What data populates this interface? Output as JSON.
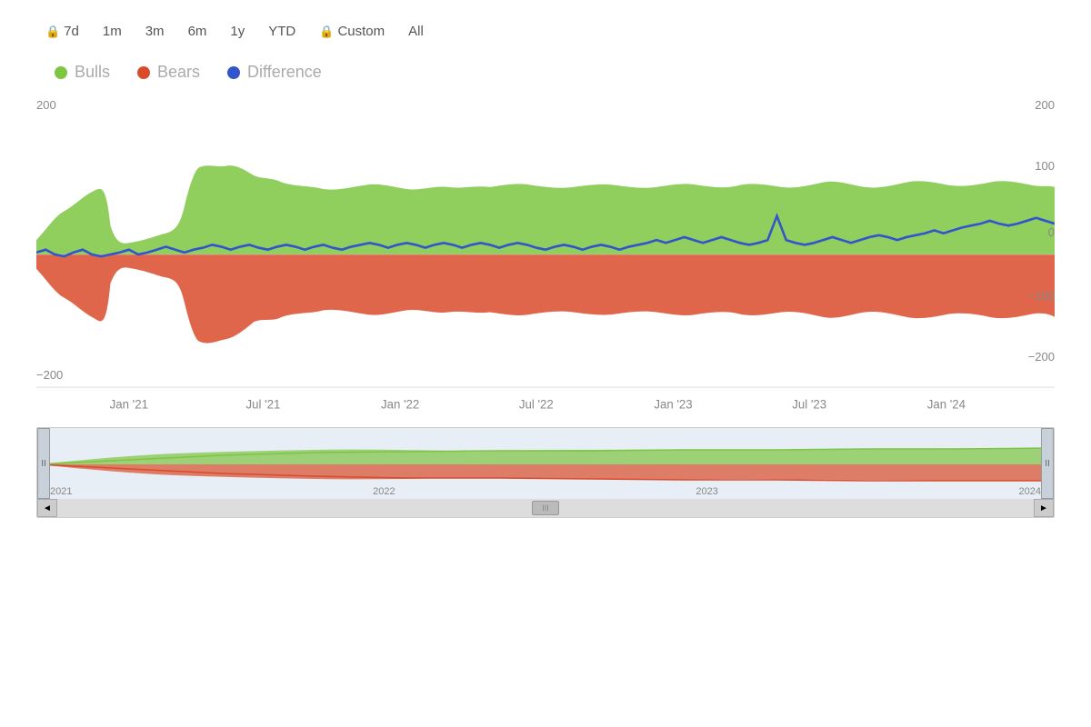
{
  "toolbar": {
    "buttons": [
      {
        "label": "7d",
        "locked": true
      },
      {
        "label": "1m",
        "locked": false
      },
      {
        "label": "3m",
        "locked": false
      },
      {
        "label": "6m",
        "locked": false
      },
      {
        "label": "1y",
        "locked": false
      },
      {
        "label": "YTD",
        "locked": false
      },
      {
        "label": "Custom",
        "locked": true
      },
      {
        "label": "All",
        "locked": false
      }
    ]
  },
  "legend": {
    "items": [
      {
        "label": "Bulls",
        "color": "#7dc542"
      },
      {
        "label": "Bears",
        "color": "#d94b2b"
      },
      {
        "label": "Difference",
        "color": "#3355cc"
      }
    ]
  },
  "chart": {
    "y_labels_left": [
      "200",
      "−200"
    ],
    "y_labels_right": [
      "200",
      "100",
      "0",
      "−100",
      "−200"
    ],
    "x_labels": [
      "Jan '21",
      "Jul '21",
      "Jan '22",
      "Jul '22",
      "Jan '23",
      "Jul '23",
      "Jan '24"
    ]
  },
  "minimap": {
    "year_labels": [
      "2021",
      "2022",
      "2023",
      "2024"
    ],
    "left_handle": "II",
    "right_handle": "II",
    "scroll_left": "◄",
    "scroll_right": "►",
    "scroll_handle": "III"
  }
}
